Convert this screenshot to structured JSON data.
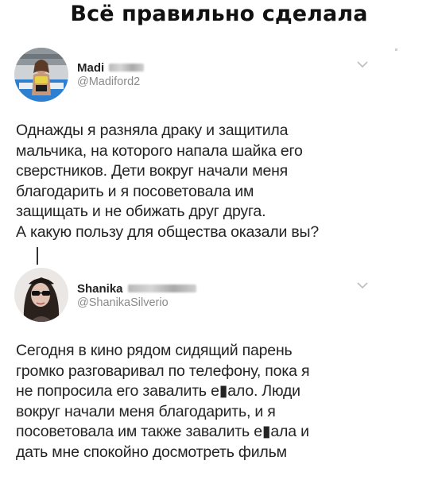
{
  "headline": "Всё правильно сделала",
  "tweets": [
    {
      "display_name": "Madi",
      "handle": "@Madiford2",
      "text": "Однажды я разняла драку и защитила\nмальчика, на которого напала шайка его\nсверстников. Дети вокруг начали меня\nблагодарить и я посоветовала им\nзащищать и не обижать друг друга.\nА какую пользу для общества оказали вы?"
    },
    {
      "display_name": "Shanika",
      "handle": "@ShanikaSilverio",
      "text": "Сегодня в кино рядом сидящий парень\nгромко разговаривал по телефону, пока я\nне попросила его завалить е▮ало. Люди\nвокруг начали меня благодарить, и я\nпосоветовала им также завалить е▮ала и\nдать мне спокойно досмотреть фильм"
    }
  ],
  "icons": {
    "menu": "chevron-down-icon",
    "avatar1": "avatar-photo",
    "avatar2": "avatar-photo"
  },
  "colors": {
    "text": "#242424",
    "muted": "#8a8a8a",
    "background": "#ffffff"
  }
}
